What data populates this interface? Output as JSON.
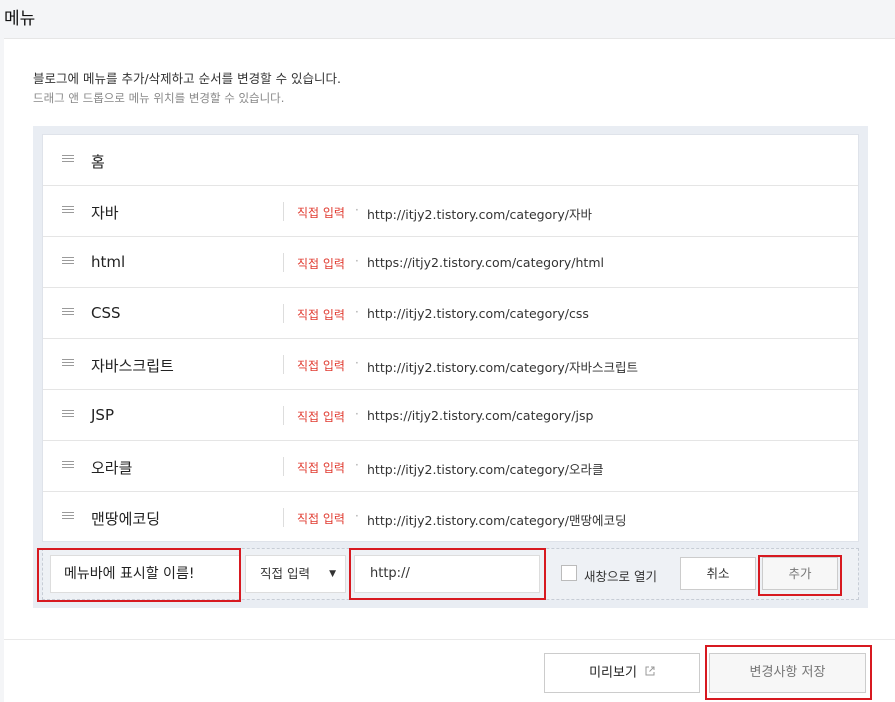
{
  "page": {
    "title": "메뉴"
  },
  "description": {
    "line1": "블로그에 메뉴를 추가/삭제하고 순서를 변경할 수 있습니다.",
    "line2": "드래그 앤 드롭으로 메뉴 위치를 변경할 수 있습니다."
  },
  "menu_items": [
    {
      "name": "홈",
      "type": "",
      "url": ""
    },
    {
      "name": "자바",
      "type": "직접 입력",
      "url": "http://itjy2.tistory.com/category/자바"
    },
    {
      "name": "html",
      "type": "직접 입력",
      "url": "https://itjy2.tistory.com/category/html"
    },
    {
      "name": "CSS",
      "type": "직접 입력",
      "url": "http://itjy2.tistory.com/category/css"
    },
    {
      "name": "자바스크립트",
      "type": "직접 입력",
      "url": "http://itjy2.tistory.com/category/자바스크립트"
    },
    {
      "name": "JSP",
      "type": "직접 입력",
      "url": "https://itjy2.tistory.com/category/jsp"
    },
    {
      "name": "오라클",
      "type": "직접 입력",
      "url": "http://itjy2.tistory.com/category/오라클"
    },
    {
      "name": "맨땅에코딩",
      "type": "직접 입력",
      "url": "http://itjy2.tistory.com/category/맨땅에코딩"
    }
  ],
  "add_form": {
    "name_placeholder": "메뉴바에 표시할 이름!",
    "type_selected": "직접 입력",
    "url_value": "http://",
    "new_window_label": "새창으로 열기",
    "cancel_label": "취소",
    "add_label": "추가"
  },
  "footer": {
    "preview_label": "미리보기",
    "save_label": "변경사항 저장"
  },
  "colors": {
    "type_text": "#e03a2f",
    "annotation": "#d71920"
  }
}
